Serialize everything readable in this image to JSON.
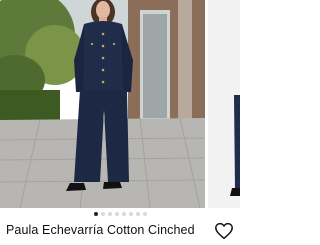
{
  "product": {
    "title": "Paula Echevarría Cotton Cinched",
    "image_count": 8,
    "active_image": 1
  },
  "icons": {
    "favorite": "heart-outline-icon"
  },
  "colors": {
    "denim": "#1f2c4a",
    "text": "#111111",
    "dot_active": "#222222",
    "dot_inactive": "#d9d9d9"
  }
}
